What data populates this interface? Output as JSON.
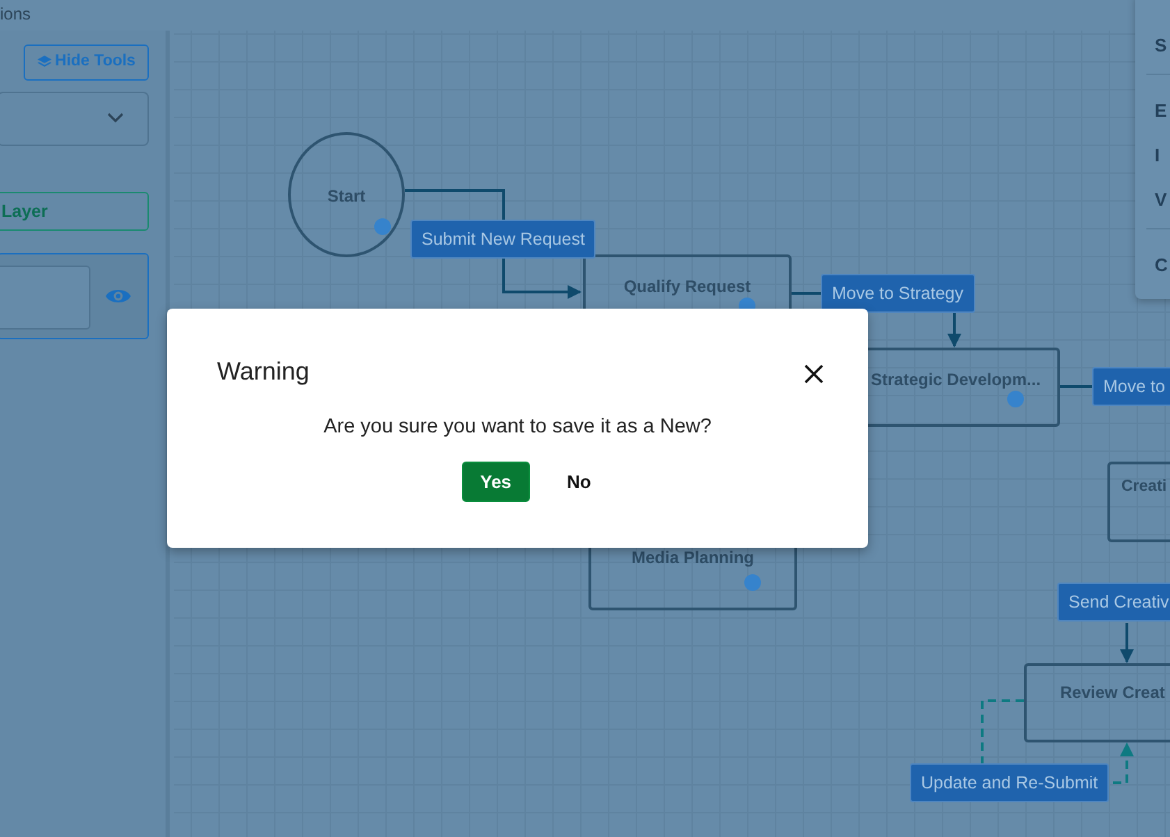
{
  "header": {
    "text": "ions"
  },
  "tools": {
    "hide_button": "Hide Tools",
    "layer_button": "Layer"
  },
  "diagram": {
    "nodes": [
      {
        "kind": "circle",
        "label": "Start",
        "dot": true
      },
      {
        "kind": "box",
        "label": "Qualify Request",
        "dot": true
      },
      {
        "kind": "box",
        "label": "Strategic Developm...",
        "dot": true
      },
      {
        "kind": "box",
        "label": "Media Planning",
        "dot": true
      },
      {
        "kind": "box",
        "label": "Creati",
        "dot": false
      },
      {
        "kind": "box",
        "label": "Review Creat",
        "dot": false
      }
    ],
    "edge_labels": [
      "Submit New Request",
      "Move to Strategy",
      "Move to",
      "Send Creativ",
      "Update and Re-Submit"
    ],
    "connectors": [
      {
        "kind": "solid"
      },
      {
        "kind": "solid"
      },
      {
        "kind": "solid"
      },
      {
        "kind": "solid"
      },
      {
        "kind": "solid"
      },
      {
        "kind": "dashed"
      },
      {
        "kind": "dashed"
      }
    ]
  },
  "menu": {
    "groups": [
      {
        "items": [
          "S"
        ]
      },
      {
        "items": [
          "E",
          "I",
          "V"
        ]
      },
      {
        "items": [
          "C"
        ]
      }
    ]
  },
  "modal": {
    "title": "Warning",
    "message": "Are you sure you want to save it as a New?",
    "buttons": [
      {
        "label": "Yes",
        "kind": "primary"
      },
      {
        "label": "No",
        "kind": "plain"
      }
    ]
  }
}
